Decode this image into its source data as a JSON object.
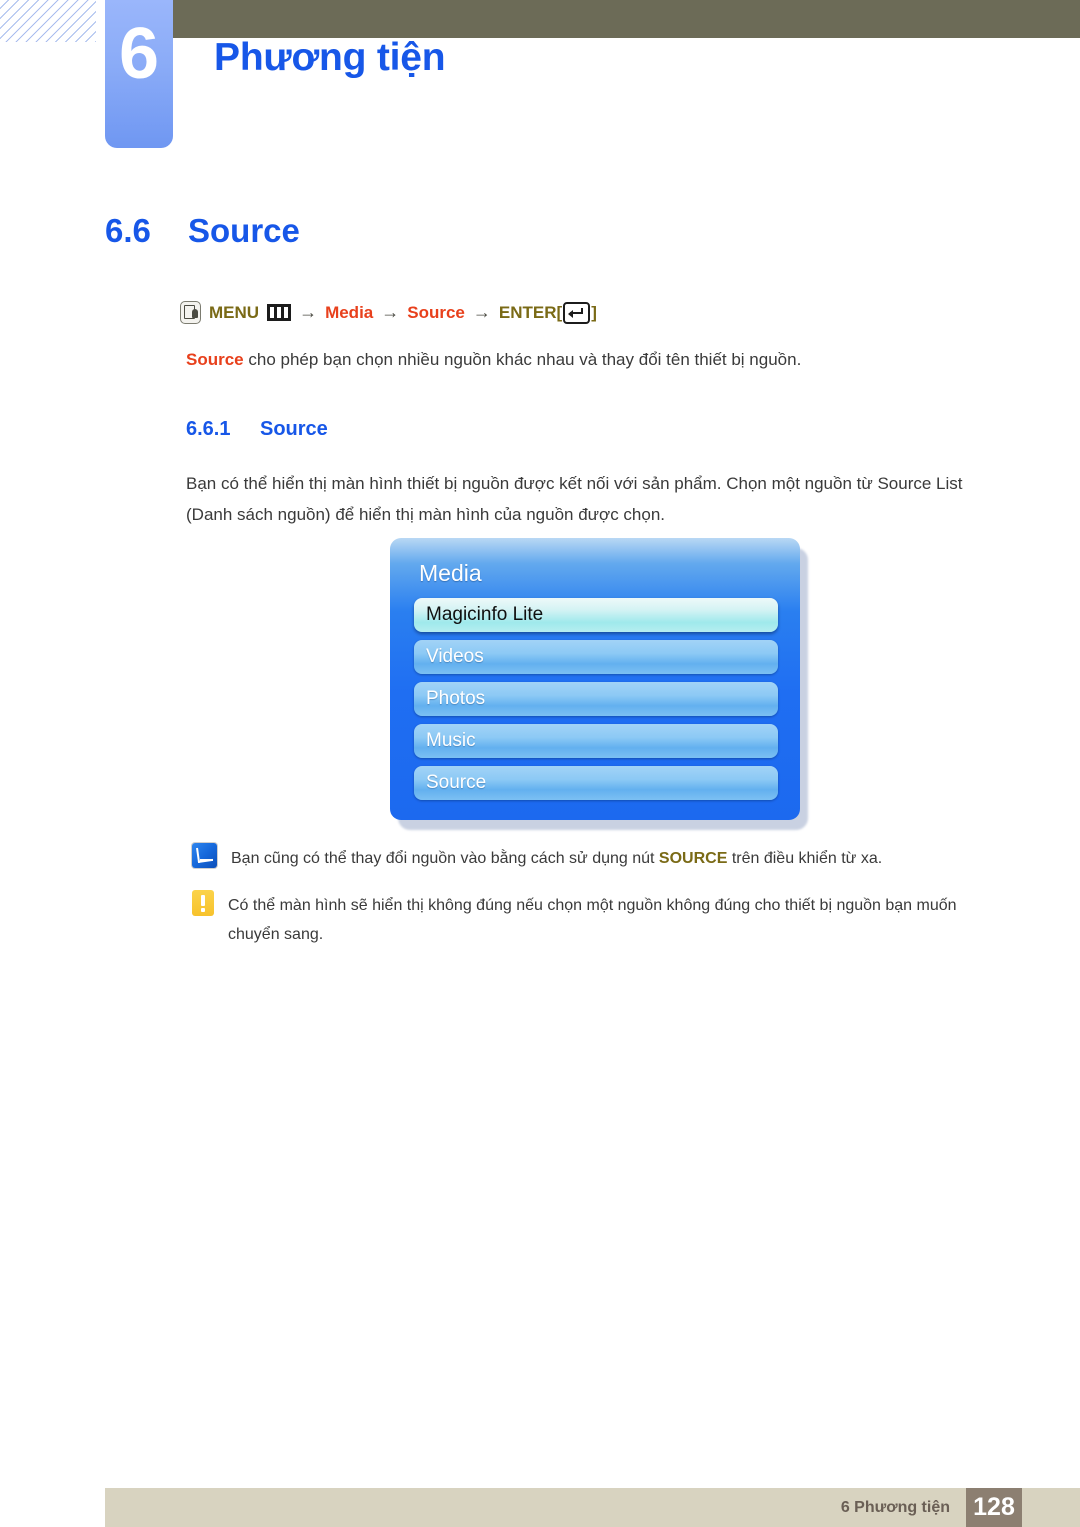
{
  "header": {
    "chapter_number": "6",
    "chapter_title": "Phương tiện"
  },
  "section": {
    "number": "6.6",
    "title": "Source"
  },
  "subsection": {
    "number": "6.6.1",
    "title": "Source"
  },
  "menu_path": {
    "press_icon": "press-button-icon",
    "menu_label": "MENU",
    "menu_icon": "menu-bars-icon",
    "arrow1": "→",
    "item1": "Media",
    "arrow2": "→",
    "item2": "Source",
    "arrow3": "→",
    "enter_label": "ENTER",
    "bracket_open": "[",
    "enter_icon": "enter-key-icon",
    "bracket_close": "]"
  },
  "lead": {
    "bold_term": "Source",
    "rest": " cho phép bạn chọn nhiều nguồn khác nhau và thay đổi tên thiết bị nguồn."
  },
  "paragraph": "Bạn có thể hiển thị màn hình thiết bị nguồn được kết nối với sản phẩm. Chọn một nguồn từ Source List (Danh sách nguồn) để hiển thị màn hình của nguồn được chọn.",
  "osd": {
    "title": "Media",
    "items": [
      {
        "label": "Magicinfo Lite",
        "selected": true
      },
      {
        "label": "Videos",
        "selected": false
      },
      {
        "label": "Photos",
        "selected": false
      },
      {
        "label": "Music",
        "selected": false
      },
      {
        "label": "Source",
        "selected": false
      }
    ]
  },
  "notes": [
    {
      "icon": "note-pencil-icon",
      "text_before": "Bạn cũng có thể thay đổi nguồn vào bằng cách sử dụng nút ",
      "emphasis": "SOURCE",
      "text_after": " trên điều khiển từ xa."
    },
    {
      "icon": "warning-exclamation-icon",
      "text": "Có thể màn hình sẽ hiển thị không đúng nếu chọn một nguồn không đúng cho thiết bị nguồn bạn muốn chuyển sang."
    }
  ],
  "footer": {
    "label": "6 Phương tiện",
    "page_number": "128"
  },
  "colors": {
    "heading_blue": "#1757e8",
    "menu_olive": "#7a6a16",
    "menu_red": "#e8401c",
    "header_bar": "#6c6b57",
    "footer_bar": "#d8d3c0",
    "footer_page_box": "#8c7f71",
    "osd_blue": "#1f6ef2",
    "osd_selected": "#9fe9ec",
    "warn_yellow": "#f7c22c"
  }
}
